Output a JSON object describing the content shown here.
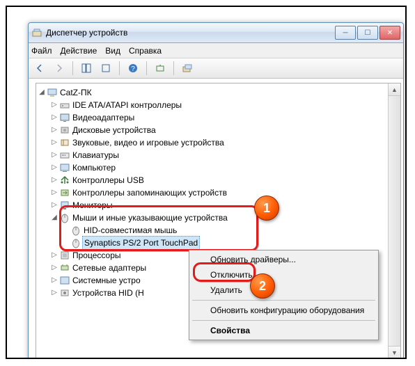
{
  "window": {
    "title": "Диспетчер устройств"
  },
  "menubar": {
    "file": "Файл",
    "action": "Действие",
    "view": "Вид",
    "help": "Справка"
  },
  "tree": {
    "root": "CatZ-ПК",
    "nodes": [
      "IDE ATA/ATAPI контроллеры",
      "Видеоадаптеры",
      "Дисковые устройства",
      "Звуковые, видео и игровые устройства",
      "Клавиатуры",
      "Компьютер",
      "Контроллеры USB",
      "Контроллеры запоминающих устройств",
      "Мониторы"
    ],
    "mouse_cat": "Мыши и иные указывающие устройства",
    "mouse_children": {
      "hid": "HID-совместимая мышь",
      "syn": "Synaptics PS/2 Port TouchPad"
    },
    "after": [
      "Процессоры",
      "Сетевые адаптеры",
      "Системные устро",
      "Устройства HID (H"
    ]
  },
  "context_menu": {
    "update": "Обновить драйверы...",
    "disable": "Отключить",
    "delete": "Удалить",
    "refresh": "Обновить конфигурацию оборудования",
    "properties": "Свойства"
  },
  "markers": {
    "m1": "1",
    "m2": "2"
  }
}
